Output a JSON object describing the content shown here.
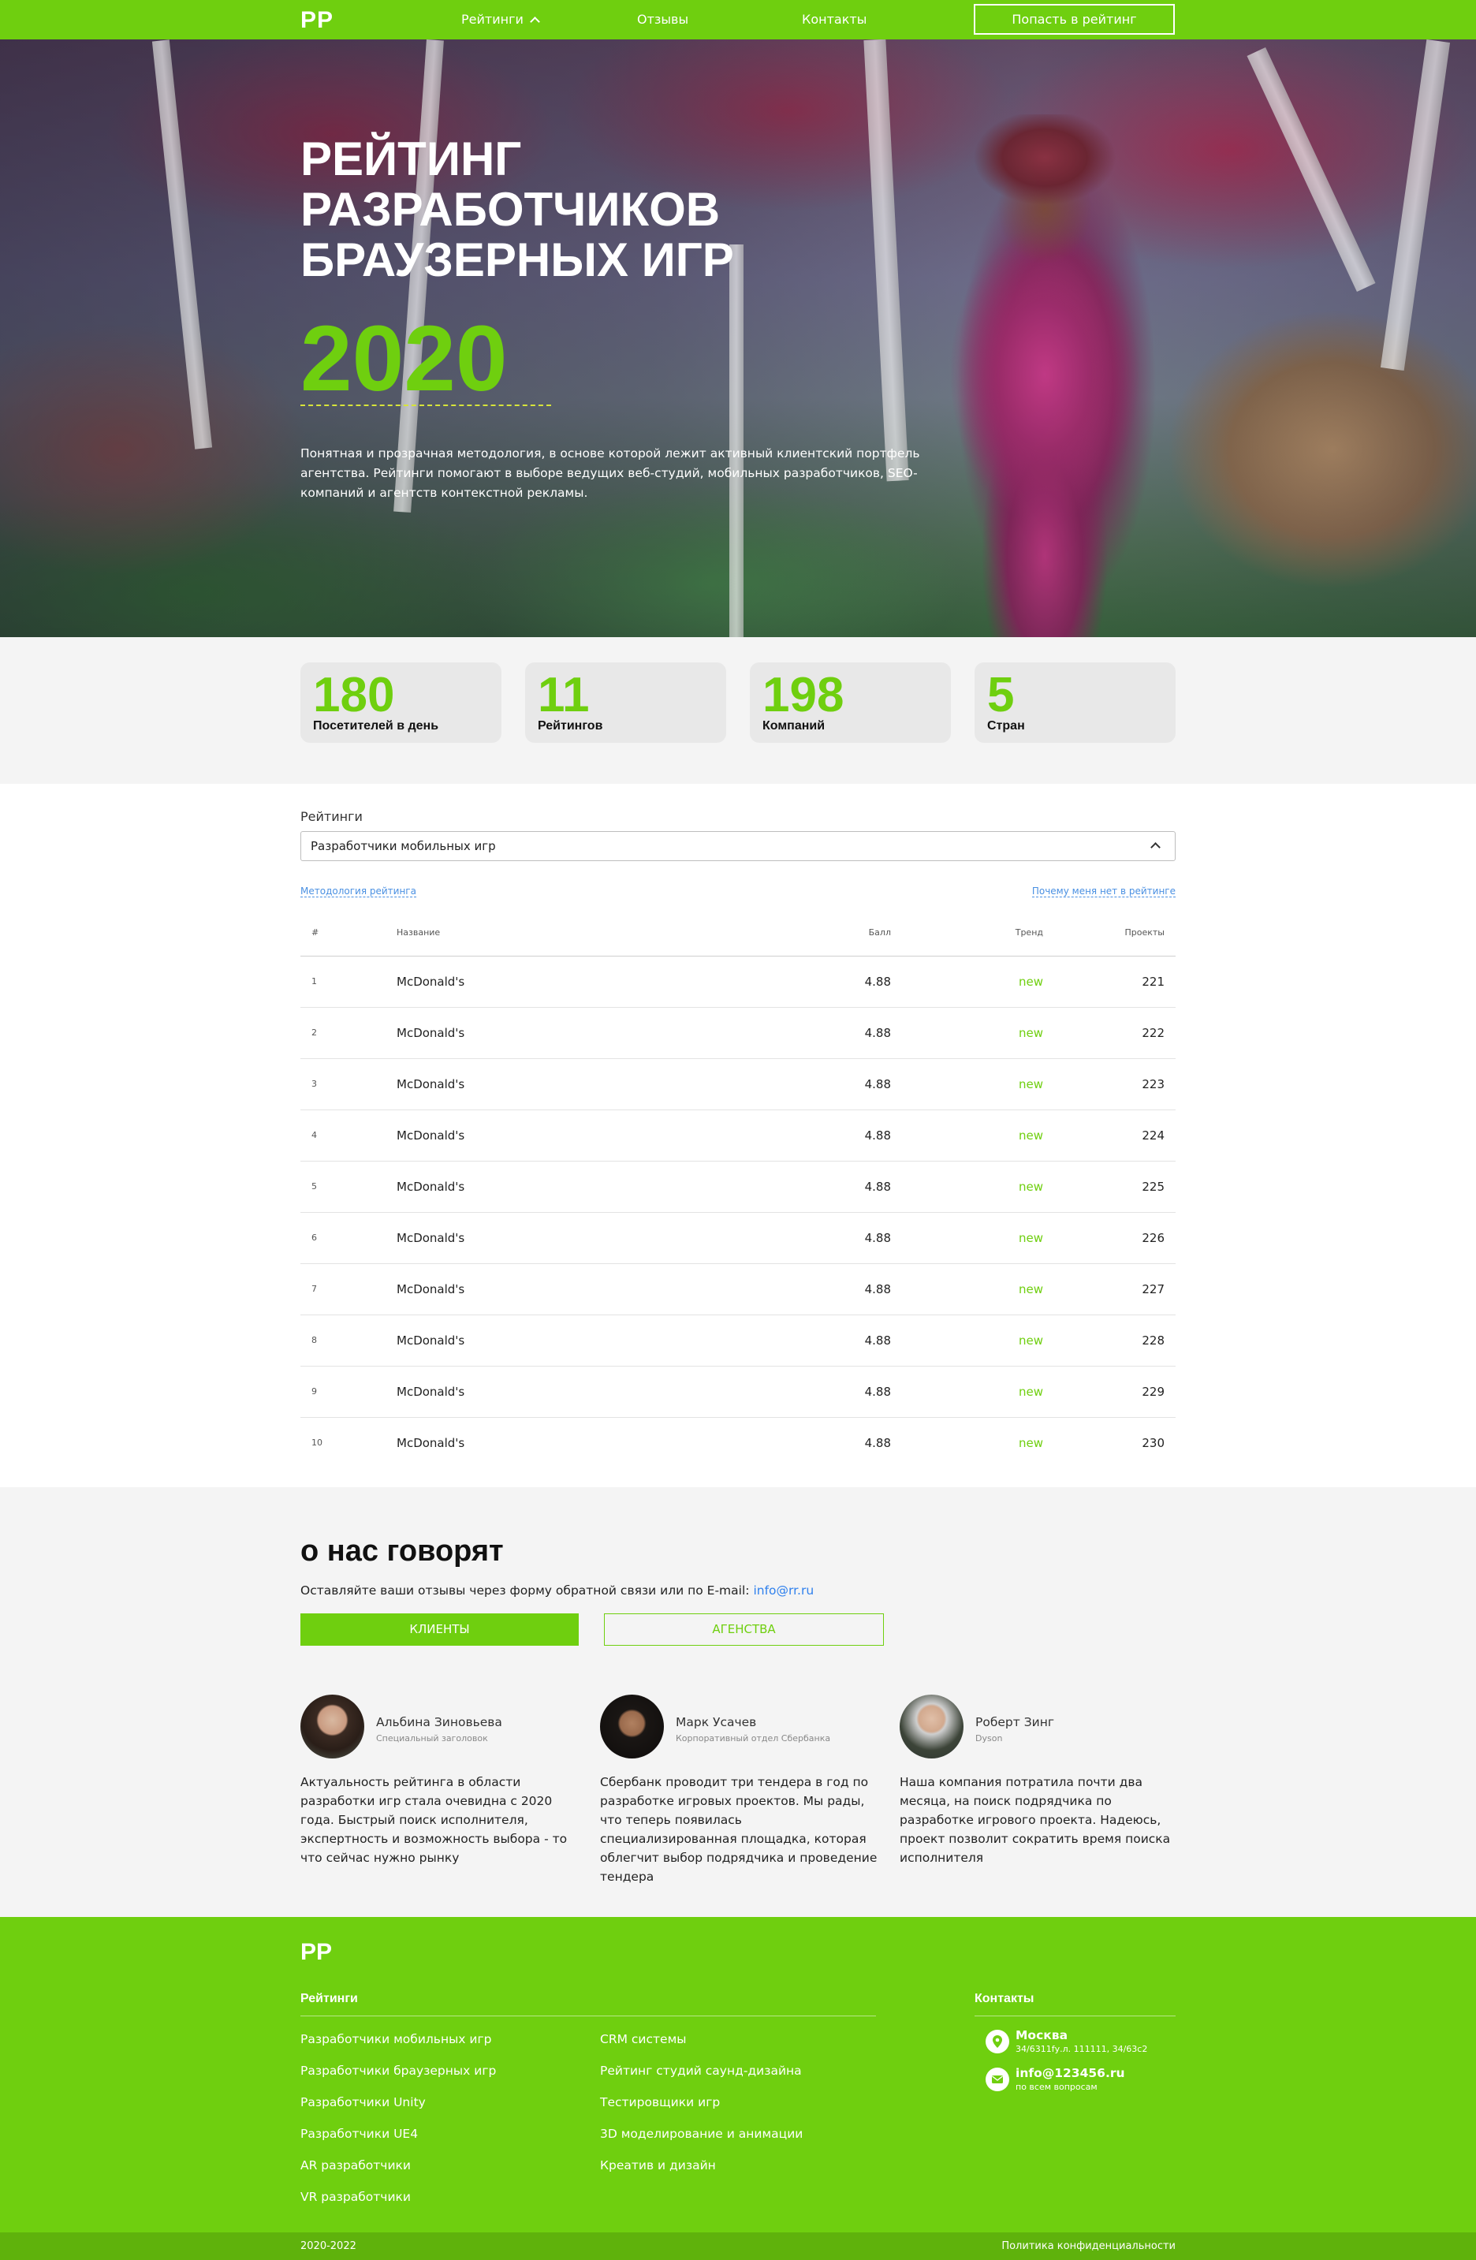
{
  "nav": {
    "logo": "PP",
    "ratings": "Рейтинги",
    "reviews": "Отзывы",
    "contacts": "Контакты",
    "cta": "Попасть в рейтинг"
  },
  "hero": {
    "title_line1": "РЕЙТИНГ",
    "title_line2": "РАЗРАБОТЧИКОВ",
    "title_line3": "БРАУЗЕРНЫХ ИГР",
    "year": "2020",
    "description": "Понятная и прозрачная методология, в основе которой лежит активный клиентский портфель агентства. Рейтинги помогают в выборе ведущих веб-студий, мобильных разработчиков, SEO-компаний и агентств контекстной рекламы."
  },
  "stats": [
    {
      "value": "180",
      "label": "Посетителей в день"
    },
    {
      "value": "11",
      "label": "Рейтингов"
    },
    {
      "value": "198",
      "label": "Компаний"
    },
    {
      "value": "5",
      "label": "Стран"
    }
  ],
  "ratings": {
    "select_label": "Рейтинги",
    "selected": "Разработчики мобильных игр",
    "methodology_link": "Методология рейтинга",
    "why_not_link": "Почему меня нет в рейтинге",
    "columns": [
      "#",
      "Название",
      "Балл",
      "Тренд",
      "Проекты"
    ],
    "rows": [
      {
        "num": "1",
        "name": "McDonald's",
        "score": "4.88",
        "trend": "new",
        "projects": "221"
      },
      {
        "num": "2",
        "name": "McDonald's",
        "score": "4.88",
        "trend": "new",
        "projects": "222"
      },
      {
        "num": "3",
        "name": "McDonald's",
        "score": "4.88",
        "trend": "new",
        "projects": "223"
      },
      {
        "num": "4",
        "name": "McDonald's",
        "score": "4.88",
        "trend": "new",
        "projects": "224"
      },
      {
        "num": "5",
        "name": "McDonald's",
        "score": "4.88",
        "trend": "new",
        "projects": "225"
      },
      {
        "num": "6",
        "name": "McDonald's",
        "score": "4.88",
        "trend": "new",
        "projects": "226"
      },
      {
        "num": "7",
        "name": "McDonald's",
        "score": "4.88",
        "trend": "new",
        "projects": "227"
      },
      {
        "num": "8",
        "name": "McDonald's",
        "score": "4.88",
        "trend": "new",
        "projects": "228"
      },
      {
        "num": "9",
        "name": "McDonald's",
        "score": "4.88",
        "trend": "new",
        "projects": "229"
      },
      {
        "num": "10",
        "name": "McDonald's",
        "score": "4.88",
        "trend": "new",
        "projects": "230"
      }
    ]
  },
  "reviews": {
    "title": "о нас говорят",
    "subtitle": "Оставляйте ваши отзывы через форму обратной связи или по E-mail:",
    "email": "info@rr.ru",
    "tab_clients": "КЛИЕНТЫ",
    "tab_agencies": "АГЕНСТВА",
    "items": [
      {
        "name": "Альбина Зиновьева",
        "role": "Специальный заголовок",
        "text": "Актуальность рейтинга в области разработки игр стала очевидна с 2020 года. Быстрый поиск исполнителя, экспертность и возможность выбора - то что сейчас нужно рынку"
      },
      {
        "name": "Марк Усачев",
        "role": "Корпоративный отдел Сбербанка",
        "text": "Сбербанк проводит три тендера в год по разработке игровых проектов. Мы рады, что теперь появилась специализированная площадка, которая облегчит выбор подрядчика и проведение тендера"
      },
      {
        "name": "Роберт Зинг",
        "role": "Dyson",
        "text": "Наша компания потратила почти два месяца, на поиск подрядчика по разработке игрового проекта. Надеюсь, проект позволит сократить время поиска исполнителя"
      }
    ]
  },
  "footer": {
    "logo": "PP",
    "ratings_heading": "Рейтинги",
    "col1": [
      "Разработчики мобильных игр",
      "Разработчики браузерных игр",
      "Разработчики Unity",
      "Разработчики UE4",
      "AR разработчики",
      "VR разработчики"
    ],
    "col2": [
      "CRM системы",
      "Рейтинг студий саунд-дизайна",
      "Тестировщики игр",
      "3D моделирование и анимации",
      "Креатив и дизайн"
    ],
    "contacts_heading": "Контакты",
    "city": "Москва",
    "address": "34/6311fу.л. 111111, 34/63с2",
    "email": "info@123456.ru",
    "email_note": "по всем вопросам",
    "copyright": "2020-2022",
    "privacy": "Политика конфиденциальности"
  },
  "colors": {
    "accent": "#6fcf0f",
    "accent_dark": "#5fb20c",
    "link": "#4a90e2"
  }
}
